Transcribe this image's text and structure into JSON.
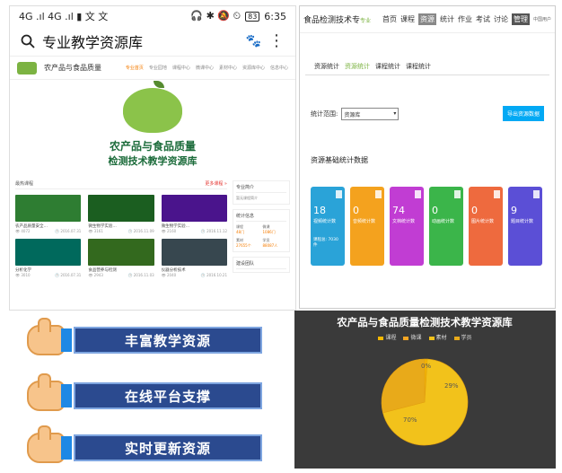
{
  "phone": {
    "status": {
      "left": "4G .ıl 4G .ıl ▮ 文 文",
      "right": "🎧 ✱ 🔕 ⏲",
      "battery": "83",
      "time": "6:35"
    },
    "search_title": "专业教学资源库",
    "site": {
      "name": "农产品与食品质量",
      "nav": [
        "专业首页",
        "专业园地",
        "课程中心",
        "微课中心",
        "素材中心",
        "资源库中心",
        "信息中心"
      ],
      "hero_line1": "农产品与食品质量",
      "hero_line2": "检测技术教学资源库"
    },
    "courses": {
      "section": "最热课程",
      "more": "更多课程 »",
      "items": [
        {
          "name": "农产品质量安全…",
          "count": "4072",
          "date": "2016.07.31",
          "color": "#2e7d32"
        },
        {
          "name": "微生物学实验…",
          "count": "3161",
          "date": "2016.11.09",
          "color": "#1b5e20"
        },
        {
          "name": "微生物学实验…",
          "count": "2160",
          "date": "2016.11.12",
          "color": "#4a148c"
        },
        {
          "name": "分析化学",
          "count": "3010",
          "date": "2016.07.31",
          "color": "#00695c"
        },
        {
          "name": "食品营养与检测",
          "count": "2943",
          "date": "2016.11.03",
          "color": "#33691e"
        },
        {
          "name": "仪器分析技术",
          "count": "2040",
          "date": "2016.10.21",
          "color": "#37474f"
        }
      ]
    },
    "side": {
      "intro": "专业简介",
      "intro_text": "暂无课程简介",
      "stats": "统计信息",
      "stat_items": [
        {
          "label": "课程",
          "value": "48门"
        },
        {
          "label": "微课",
          "value": "1086门"
        },
        {
          "label": "素材",
          "value": "27655个"
        },
        {
          "label": "学员",
          "value": "88087人"
        }
      ],
      "team": "建设团队"
    }
  },
  "dashboard": {
    "brand": "食品检测技术专",
    "brand_sub": "专业",
    "nav": [
      "首页",
      "课程",
      "资源",
      "统计",
      "作业",
      "考试",
      "讨论"
    ],
    "nav_active": "统计",
    "mgmt": "管理",
    "login": "中国用户",
    "tabs": [
      "资源统计",
      "资源统计",
      "课程统计",
      "课程统计"
    ],
    "range_label": "统计范围:",
    "select_value": "资源库",
    "export": "导出资源数据",
    "data_title": "资源基础统计数据",
    "tiles": [
      {
        "num": "18",
        "label": "视频统计数",
        "sub": "课程总: 7030件",
        "color": "#2aa3d8"
      },
      {
        "num": "0",
        "label": "音频统计数",
        "sub": "",
        "color": "#f4a21e"
      },
      {
        "num": "74",
        "label": "文档统计数",
        "sub": "",
        "color": "#c13dd3"
      },
      {
        "num": "0",
        "label": "动画统计数",
        "sub": "",
        "color": "#3bb54a"
      },
      {
        "num": "0",
        "label": "图片统计数",
        "sub": "",
        "color": "#ee6a3e"
      },
      {
        "num": "9",
        "label": "题目统计数",
        "sub": "",
        "color": "#5b4fd6"
      }
    ]
  },
  "banners": [
    "丰富教学资源",
    "在线平台支撑",
    "实时更新资源"
  ],
  "chart_data": {
    "type": "pie",
    "title": "农产品与食品质量检测技术教学资源库",
    "series": [
      {
        "name": "课程",
        "value": 1,
        "color": "#f5b800"
      },
      {
        "name": "微课",
        "value": 0,
        "color": "#f5a623"
      },
      {
        "name": "素材",
        "value": 70,
        "color": "#f2c21b"
      },
      {
        "name": "学员",
        "value": 29,
        "color": "#e8aa1a"
      }
    ],
    "labels": [
      "0%",
      "29%",
      "70%"
    ]
  }
}
